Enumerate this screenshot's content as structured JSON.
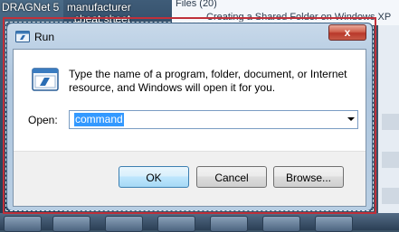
{
  "background": {
    "left_item_1": "DRAGNet 5",
    "top_item_1": "manufacturer",
    "top_item_2": "cheat sheet",
    "right_window_text_1": "Files (20)",
    "right_window_text_2": "Creating a Shared Folder on Windows XP"
  },
  "dialog": {
    "title": "Run",
    "close_glyph": "x",
    "description": "Type the name of a program, folder, document, or Internet resource, and Windows will open it for you.",
    "open_label": "Open:",
    "open_value": "command",
    "buttons": {
      "ok": "OK",
      "cancel": "Cancel",
      "browse": "Browse..."
    }
  },
  "colors": {
    "selection_frame": "#c0303a",
    "close_button": "#c8483a",
    "text_selection": "#3399ff"
  },
  "icons": {
    "title": "run-icon",
    "main": "run-program-icon",
    "close": "close-icon",
    "dropdown": "chevron-down-icon"
  }
}
